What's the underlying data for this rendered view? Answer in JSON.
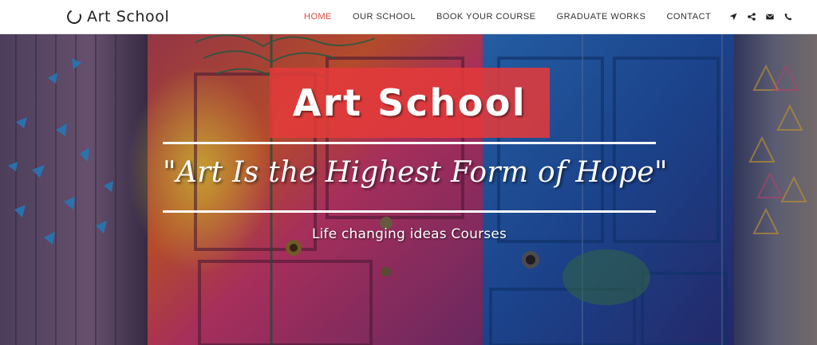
{
  "brand": {
    "name": "Art School",
    "icon": "ring-logo-icon"
  },
  "nav": {
    "items": [
      {
        "label": "HOME",
        "active": true
      },
      {
        "label": "OUR SCHOOL",
        "active": false
      },
      {
        "label": "BOOK YOUR COURSE",
        "active": false
      },
      {
        "label": "GRADUATE WORKS",
        "active": false
      },
      {
        "label": "CONTACT",
        "active": false
      }
    ],
    "icons": [
      "location-arrow-icon",
      "share-icon",
      "envelope-icon",
      "phone-icon"
    ],
    "active_color": "#e24b3f"
  },
  "hero": {
    "title": "Art School",
    "quote": "\"Art Is the Highest Form of Hope\"",
    "subtitle": "Life changing ideas Courses",
    "title_box_color": "#e23a3a",
    "background": "graffiti-painted-doors-image"
  }
}
